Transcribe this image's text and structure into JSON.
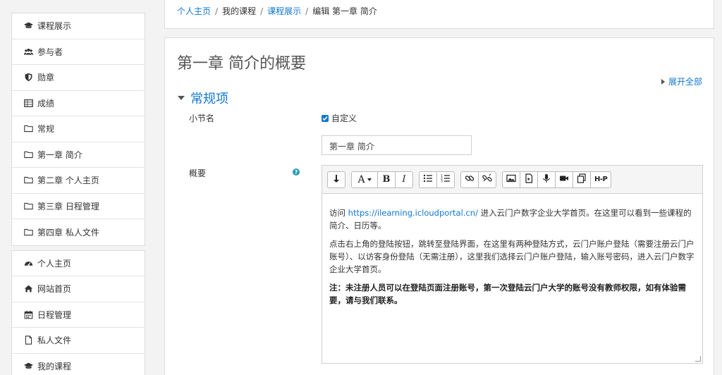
{
  "sidebar": {
    "course_nav": [
      {
        "label": "课程展示",
        "icon": "graduation-cap-icon"
      },
      {
        "label": "参与者",
        "icon": "users-icon"
      },
      {
        "label": "勋章",
        "icon": "shield-icon"
      },
      {
        "label": "成绩",
        "icon": "table-icon"
      },
      {
        "label": "常规",
        "icon": "folder-icon"
      },
      {
        "label": "第一章 简介",
        "icon": "folder-icon"
      },
      {
        "label": "第二章 个人主页",
        "icon": "folder-icon"
      },
      {
        "label": "第三章 日程管理",
        "icon": "folder-icon"
      },
      {
        "label": "第四章 私人文件",
        "icon": "folder-icon"
      }
    ],
    "site_nav": [
      {
        "label": "个人主页",
        "icon": "dashboard-icon"
      },
      {
        "label": "网站首页",
        "icon": "home-icon"
      },
      {
        "label": "日程管理",
        "icon": "calendar-icon"
      },
      {
        "label": "私人文件",
        "icon": "file-icon"
      },
      {
        "label": "我的课程",
        "icon": "graduation-cap-icon"
      }
    ]
  },
  "breadcrumb": {
    "items": [
      "个人主页",
      "我的课程",
      "课程展示",
      "编辑 第一章 简介"
    ]
  },
  "main": {
    "title": "第一章 简介的概要",
    "expand_all": "展开全部",
    "section_title": "常规项",
    "section_name_label": "小节名",
    "custom_label": "自定义",
    "section_name_value": "第一章 简介",
    "summary_label": "概要",
    "help_glyph": "?"
  },
  "editor": {
    "toolbar": {
      "font_label": "A",
      "bold": "B",
      "italic": "I",
      "h5p": "H-P"
    },
    "content": {
      "p1_prefix": "访问 ",
      "p1_link": "https://ilearning.icloudportal.cn/",
      "p1_suffix": " 进入云门户数字企业大学首页。在这里可以看到一些课程的简介、日历等。",
      "p2": "点击右上角的登陆按钮，跳转至登陆界面，在这里有两种登陆方式，云门户账户登陆（需要注册云门户账号）、以访客身份登陆（无需注册），这里我们选择云门户账户登陆，输入账号密码，进入云门户数字企业大学首页。",
      "p3": "注：未注册人员可以在登陆页面注册账号，第一次登陆云门户大学的账号没有教师权限，如有体验需要，请与我们联系。"
    }
  },
  "colors": {
    "link": "#1177d1",
    "help": "#2a9bb6"
  }
}
